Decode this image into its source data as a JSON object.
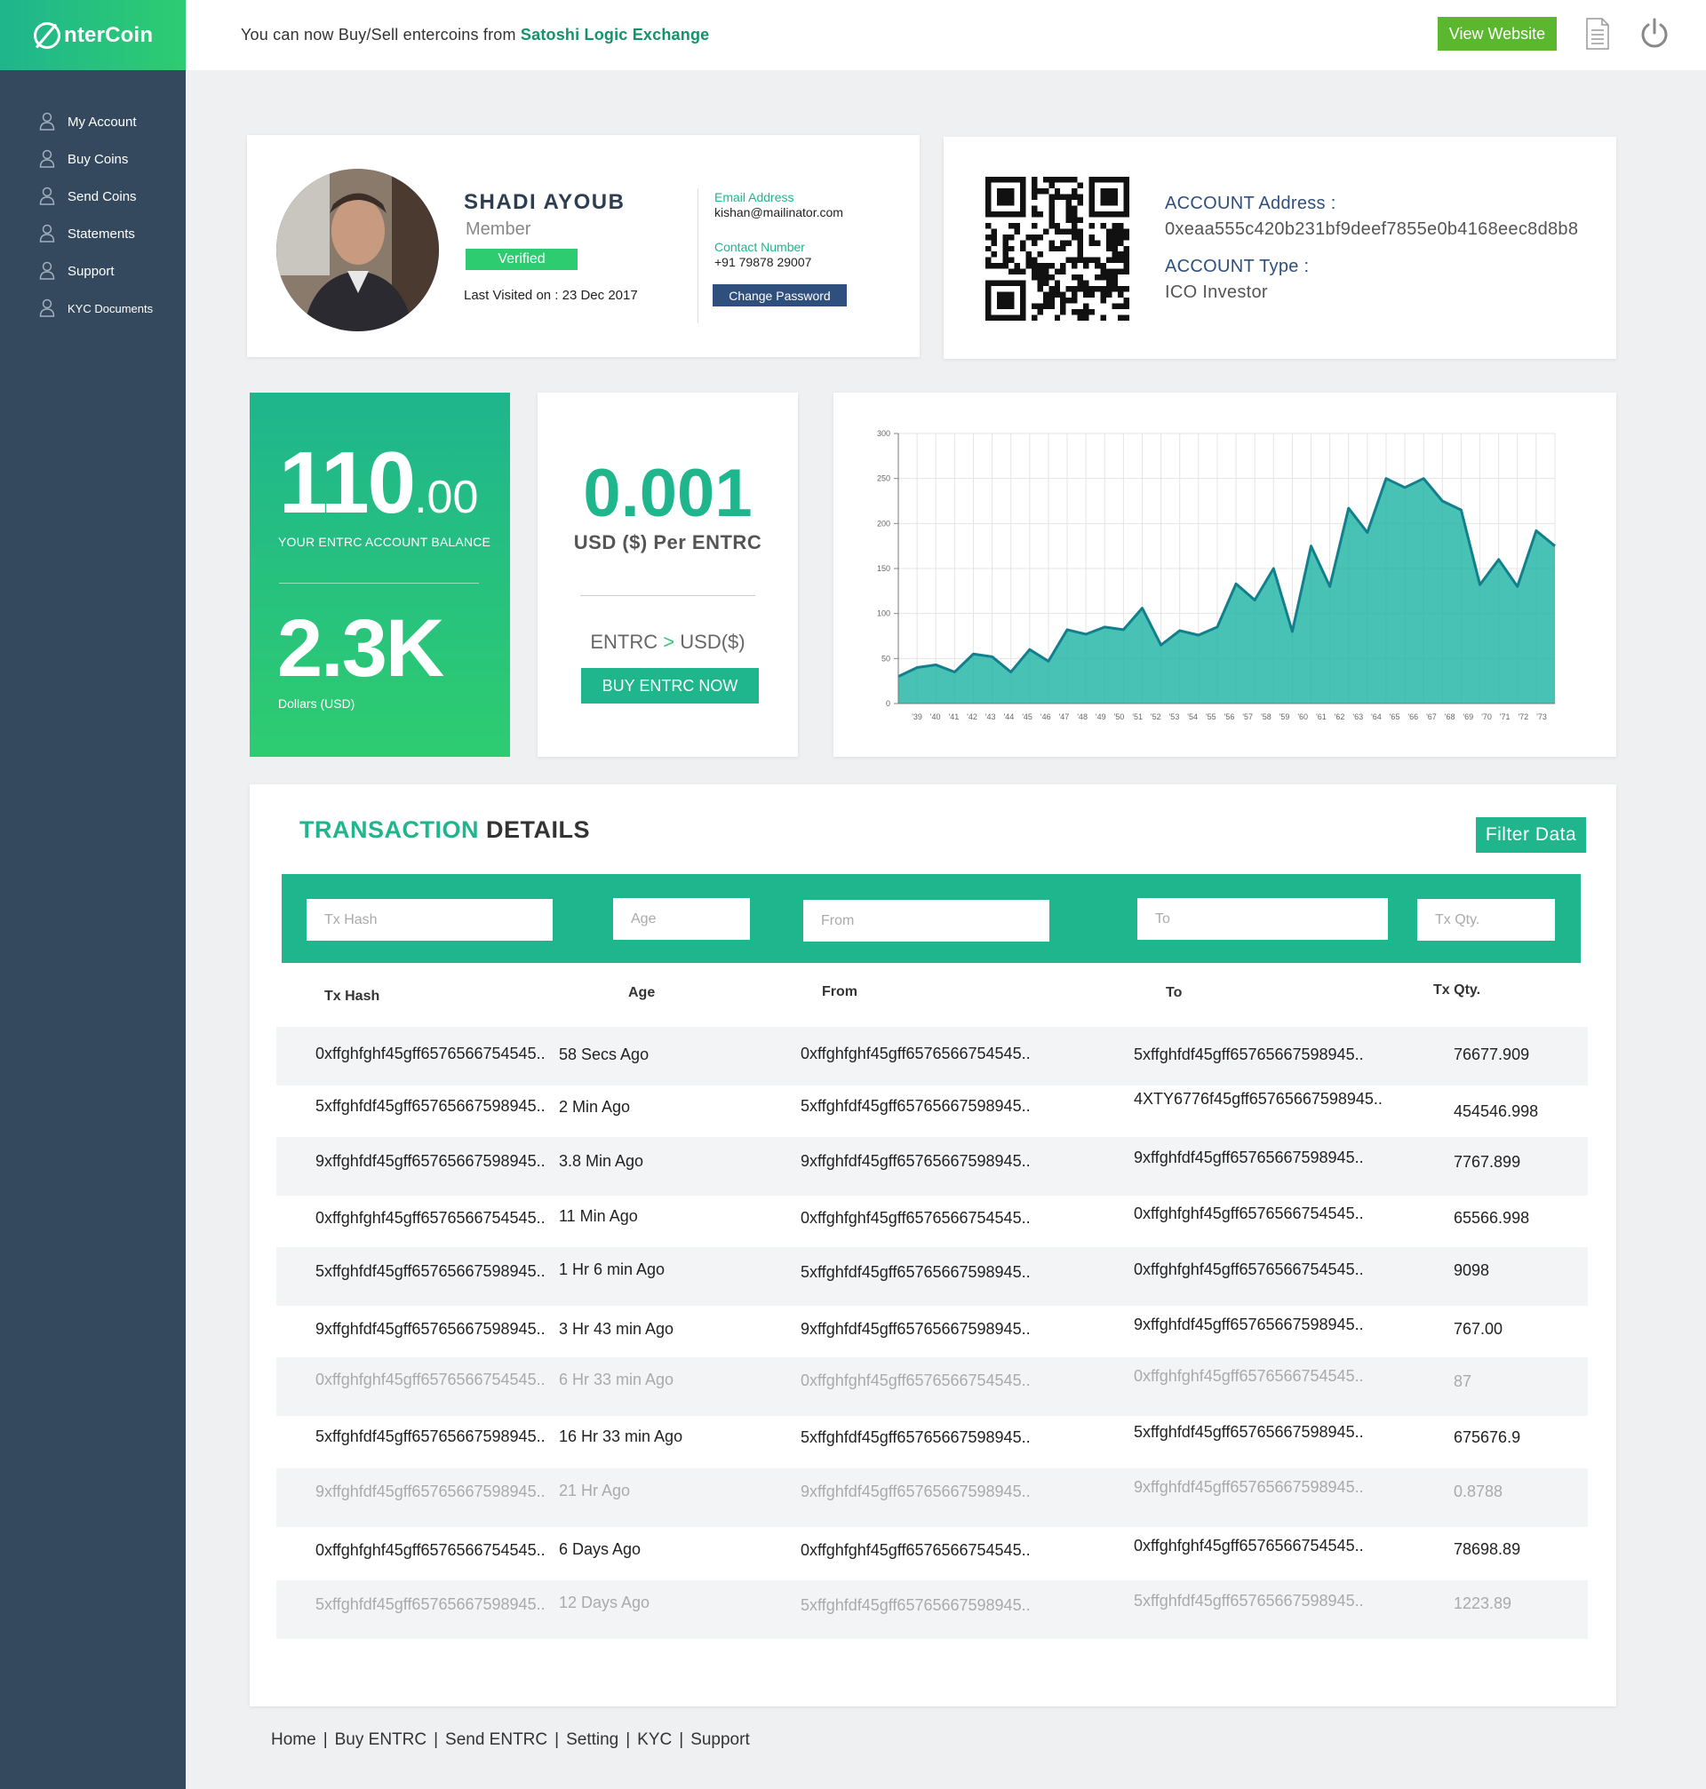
{
  "brand": {
    "name": "nterCoin",
    "logo_icon": "entercoin-logo-icon"
  },
  "sidebar": {
    "items": [
      {
        "label": "My Account",
        "icon": "user-icon"
      },
      {
        "label": "Buy Coins",
        "icon": "user-icon"
      },
      {
        "label": "Send Coins",
        "icon": "user-icon"
      },
      {
        "label": "Statements",
        "icon": "user-icon"
      },
      {
        "label": "Support",
        "icon": "user-icon"
      },
      {
        "label": "KYC Documents",
        "icon": "user-icon"
      }
    ]
  },
  "header": {
    "announcement_prefix": "You can now Buy/Sell entercoins from ",
    "announcement_link": "Satoshi Logic Exchange",
    "view_website": "View Website",
    "icons": [
      "document-icon",
      "power-icon"
    ]
  },
  "profile": {
    "name": "SHADI AYOUB",
    "role": "Member",
    "verified": "Verified",
    "last_visited": "Last Visited on : 23 Dec 2017",
    "email_label": "Email Address",
    "email": "kishan@mailinator.com",
    "contact_label": "Contact Number",
    "contact": "+91 79878 29007",
    "change_password": "Change Password"
  },
  "account": {
    "address_label": "ACCOUNT Address :",
    "address": "0xeaa555c420b231bf9deef7855e0b4168eec8d8b8",
    "type_label": "ACCOUNT Type :",
    "type": "ICO Investor"
  },
  "balance": {
    "entrc_int": "110",
    "entrc_dec": ".00",
    "entrc_label": "YOUR ENTRC ACCOUNT BALANCE",
    "usd": "2.3K",
    "usd_label": "Dollars (USD)"
  },
  "rate": {
    "value": "0.001",
    "label": "USD ($) Per ENTRC",
    "pair_from": "ENTRC",
    "pair_arrow": ">",
    "pair_to": "USD($)",
    "buy_button": "BUY ENTRC NOW"
  },
  "chart_data": {
    "type": "area",
    "x": [
      "'39",
      "'40",
      "'41",
      "'42",
      "'43",
      "'44",
      "'45",
      "'46",
      "'47",
      "'48",
      "'49",
      "'50",
      "'51",
      "'52",
      "'53",
      "'54",
      "'55",
      "'56",
      "'57",
      "'58",
      "'59",
      "'60",
      "'61",
      "'62",
      "'63",
      "'64",
      "'65",
      "'66",
      "'67",
      "'68",
      "'69",
      "'70",
      "'71",
      "'72",
      "'73"
    ],
    "values": [
      30,
      40,
      43,
      35,
      55,
      52,
      35,
      60,
      47,
      82,
      77,
      85,
      82,
      106,
      65,
      81,
      76,
      85,
      133,
      115,
      150,
      80,
      175,
      130,
      217,
      190,
      250,
      240,
      250,
      225,
      215,
      132,
      160,
      130,
      192,
      175
    ],
    "ylim": [
      0,
      300
    ],
    "yticks": [
      0,
      50,
      100,
      150,
      200,
      250,
      300
    ],
    "grid": true,
    "color": "#1fb5a5"
  },
  "transactions": {
    "title_accent": "TRANSACTION",
    "title_rest": " DETAILS",
    "filter_button": "Filter Data",
    "filters": {
      "hash": "Tx Hash",
      "age": "Age",
      "from": "From",
      "to": "To",
      "qty": "Tx Qty."
    },
    "columns": {
      "hash": "Tx Hash",
      "age": "Age",
      "from": "From",
      "to": "To",
      "qty": "Tx Qty."
    },
    "rows": [
      {
        "hash": "0xffghfghf45gff6576566754545..",
        "age": "58 Secs Ago",
        "from": "0xffghfghf45gff6576566754545..",
        "to": "5xffghfdf45gff65765667598945..",
        "qty": "76677.909"
      },
      {
        "hash": "5xffghfdf45gff65765667598945..",
        "age": "2 Min Ago",
        "from": "5xffghfdf45gff65765667598945..",
        "to": "4XTY6776f45gff65765667598945..",
        "qty": "454546.998"
      },
      {
        "hash": "9xffghfdf45gff65765667598945..",
        "age": "3.8 Min Ago",
        "from": "9xffghfdf45gff65765667598945..",
        "to": "9xffghfdf45gff65765667598945..",
        "qty": "7767.899"
      },
      {
        "hash": "0xffghfghf45gff6576566754545..",
        "age": "11 Min Ago",
        "from": "0xffghfghf45gff6576566754545..",
        "to": "0xffghfghf45gff6576566754545..",
        "qty": "65566.998"
      },
      {
        "hash": "5xffghfdf45gff65765667598945..",
        "age": "1 Hr 6 min Ago",
        "from": "5xffghfdf45gff65765667598945..",
        "to": "0xffghfghf45gff6576566754545..",
        "qty": "9098"
      },
      {
        "hash": "9xffghfdf45gff65765667598945..",
        "age": "3 Hr 43 min Ago",
        "from": "9xffghfdf45gff65765667598945..",
        "to": "9xffghfdf45gff65765667598945..",
        "qty": "767.00"
      },
      {
        "hash": "0xffghfghf45gff6576566754545..",
        "age": "6 Hr 33 min Ago",
        "from": "0xffghfghf45gff6576566754545..",
        "to": "0xffghfghf45gff6576566754545..",
        "qty": "87"
      },
      {
        "hash": "5xffghfdf45gff65765667598945..",
        "age": "16 Hr 33 min Ago",
        "from": "5xffghfdf45gff65765667598945..",
        "to": "5xffghfdf45gff65765667598945..",
        "qty": "675676.9"
      },
      {
        "hash": "9xffghfdf45gff65765667598945..",
        "age": "21 Hr  Ago",
        "from": "9xffghfdf45gff65765667598945..",
        "to": "9xffghfdf45gff65765667598945..",
        "qty": "0.8788"
      },
      {
        "hash": "0xffghfghf45gff6576566754545..",
        "age": "6 Days  Ago",
        "from": "0xffghfghf45gff6576566754545..",
        "to": "0xffghfghf45gff6576566754545..",
        "qty": "78698.89"
      },
      {
        "hash": "5xffghfdf45gff65765667598945..",
        "age": "12 Days  Ago",
        "from": "5xffghfdf45gff65765667598945..",
        "to": "5xffghfdf45gff65765667598945..",
        "qty": "1223.89"
      }
    ]
  },
  "footer": {
    "links": [
      "Home",
      "Buy ENTRC",
      "Send ENTRC",
      "Setting",
      "KYC",
      "Support"
    ],
    "separator": "|"
  }
}
